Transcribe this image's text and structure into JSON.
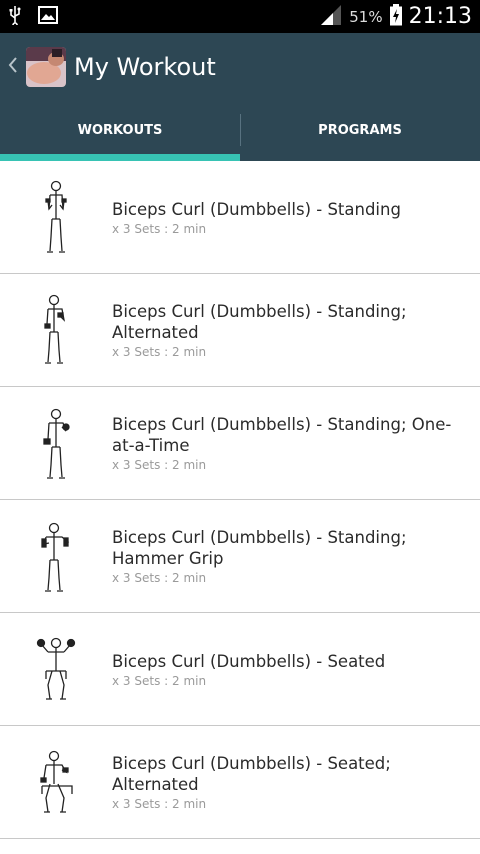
{
  "status": {
    "battery_pct": "51%",
    "time": "21:13"
  },
  "appbar": {
    "title": "My Workout"
  },
  "tabs": [
    {
      "label": "WORKOUTS",
      "active": true
    },
    {
      "label": "PROGRAMS",
      "active": false
    }
  ],
  "exercises": [
    {
      "name": "Biceps Curl (Dumbbells) - Standing",
      "meta": "x 3 Sets : 2 min"
    },
    {
      "name": "Biceps Curl (Dumbbells) - Standing; Alternated",
      "meta": "x 3 Sets : 2 min"
    },
    {
      "name": "Biceps Curl (Dumbbells) - Standing; One-at-a-Time",
      "meta": "x 3 Sets : 2 min"
    },
    {
      "name": "Biceps Curl (Dumbbells) - Standing; Hammer Grip",
      "meta": "x 3 Sets : 2 min"
    },
    {
      "name": "Biceps Curl (Dumbbells) - Seated",
      "meta": "x 3 Sets : 2 min"
    },
    {
      "name": "Biceps Curl (Dumbbells) - Seated; Alternated",
      "meta": "x 3 Sets : 2 min"
    }
  ],
  "colors": {
    "appbar": "#2d4754",
    "tab_indicator": "#37c3b4"
  }
}
